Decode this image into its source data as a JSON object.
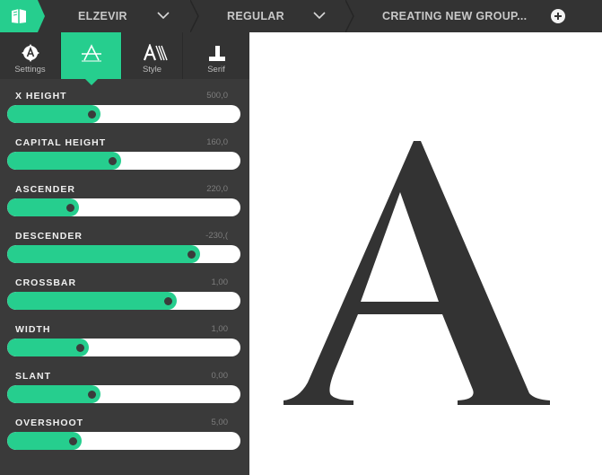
{
  "topbar": {
    "logo_icon": "prototypo-book-icon",
    "family": "ELZEVIR",
    "variant": "REGULAR",
    "group": "CREATING NEW GROUP...",
    "add_icon": "plus-circle-icon"
  },
  "tabs": [
    {
      "label": "Settings",
      "icon": "settings-a-icon",
      "active": false
    },
    {
      "label": "",
      "icon": "crossbar-a-icon",
      "active": true
    },
    {
      "label": "Style",
      "icon": "style-a-icon",
      "active": false
    },
    {
      "label": "Serif",
      "icon": "serif-icon",
      "active": false
    }
  ],
  "sliders": [
    {
      "label": "X HEIGHT",
      "value": "500,0",
      "fraction": 0.36
    },
    {
      "label": "CAPITAL HEIGHT",
      "value": "160,0",
      "fraction": 0.45
    },
    {
      "label": "ASCENDER",
      "value": "220,0",
      "fraction": 0.27
    },
    {
      "label": "DESCENDER",
      "value": "-230,(",
      "fraction": 0.79
    },
    {
      "label": "CROSSBAR",
      "value": "1,00",
      "fraction": 0.69
    },
    {
      "label": "WIDTH",
      "value": "1,00",
      "fraction": 0.31
    },
    {
      "label": "SLANT",
      "value": "0,00",
      "fraction": 0.36
    },
    {
      "label": "OVERSHOOT",
      "value": "5,00",
      "fraction": 0.28
    }
  ],
  "preview": {
    "glyph": "A"
  },
  "colors": {
    "accent": "#26ce8e",
    "topbar": "#333333",
    "sidebar": "#3a3a3a",
    "glyph": "#333333"
  }
}
